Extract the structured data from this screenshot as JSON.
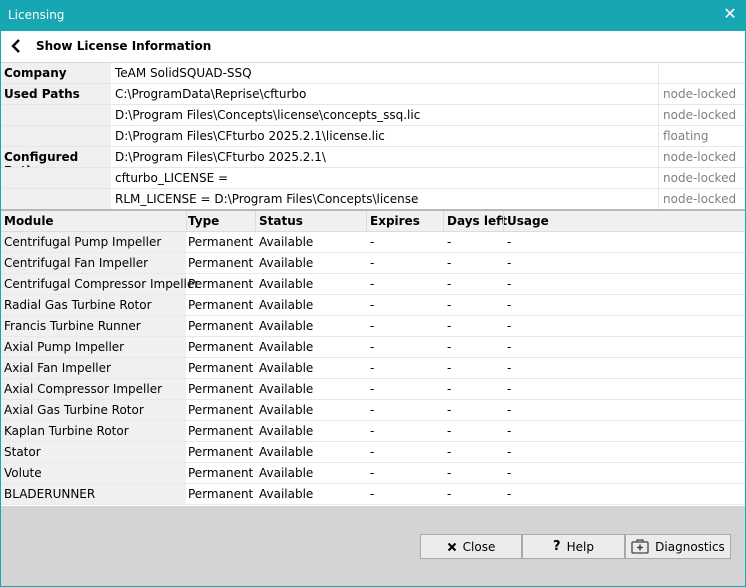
{
  "window": {
    "title": "Licensing"
  },
  "nav": {
    "back_label": "Show License Information"
  },
  "info_rows": [
    {
      "label": "Company",
      "value": "TeAM SolidSQUAD-SSQ",
      "type": ""
    },
    {
      "label": "Used Paths",
      "value": "C:\\ProgramData\\Reprise\\cfturbo",
      "type": "node-locked"
    },
    {
      "label": "",
      "value": "D:\\Program Files\\Concepts\\license\\concepts_ssq.lic",
      "type": "node-locked"
    },
    {
      "label": "",
      "value": "D:\\Program Files\\CFturbo 2025.2.1\\license.lic",
      "type": "floating"
    },
    {
      "label": "Configured Paths",
      "value": "D:\\Program Files\\CFturbo 2025.2.1\\",
      "type": "node-locked"
    },
    {
      "label": "",
      "value": "cfturbo_LICENSE =",
      "type": "node-locked"
    },
    {
      "label": "",
      "value": "RLM_LICENSE = D:\\Program Files\\Concepts\\license",
      "type": "node-locked"
    }
  ],
  "modules": {
    "headers": {
      "module": "Module",
      "type": "Type",
      "status": "Status",
      "expires": "Expires",
      "days_left": "Days left",
      "usage": "Usage"
    },
    "rows": [
      {
        "module": "Centrifugal Pump Impeller",
        "type": "Permanent",
        "status": "Available",
        "expires": "-",
        "days_left": "-",
        "usage": "-"
      },
      {
        "module": "Centrifugal Fan Impeller",
        "type": "Permanent",
        "status": "Available",
        "expires": "-",
        "days_left": "-",
        "usage": "-"
      },
      {
        "module": "Centrifugal Compressor Impeller",
        "type": "Permanent",
        "status": "Available",
        "expires": "-",
        "days_left": "-",
        "usage": "-"
      },
      {
        "module": "Radial Gas Turbine Rotor",
        "type": "Permanent",
        "status": "Available",
        "expires": "-",
        "days_left": "-",
        "usage": "-"
      },
      {
        "module": "Francis Turbine Runner",
        "type": "Permanent",
        "status": "Available",
        "expires": "-",
        "days_left": "-",
        "usage": "-"
      },
      {
        "module": "Axial Pump Impeller",
        "type": "Permanent",
        "status": "Available",
        "expires": "-",
        "days_left": "-",
        "usage": "-"
      },
      {
        "module": "Axial Fan Impeller",
        "type": "Permanent",
        "status": "Available",
        "expires": "-",
        "days_left": "-",
        "usage": "-"
      },
      {
        "module": "Axial Compressor Impeller",
        "type": "Permanent",
        "status": "Available",
        "expires": "-",
        "days_left": "-",
        "usage": "-"
      },
      {
        "module": "Axial Gas Turbine Rotor",
        "type": "Permanent",
        "status": "Available",
        "expires": "-",
        "days_left": "-",
        "usage": "-"
      },
      {
        "module": "Kaplan Turbine Rotor",
        "type": "Permanent",
        "status": "Available",
        "expires": "-",
        "days_left": "-",
        "usage": "-"
      },
      {
        "module": "Stator",
        "type": "Permanent",
        "status": "Available",
        "expires": "-",
        "days_left": "-",
        "usage": "-"
      },
      {
        "module": "Volute",
        "type": "Permanent",
        "status": "Available",
        "expires": "-",
        "days_left": "-",
        "usage": "-"
      },
      {
        "module": "BLADERUNNER",
        "type": "Permanent",
        "status": "Available",
        "expires": "-",
        "days_left": "-",
        "usage": "-"
      }
    ]
  },
  "buttons": {
    "close": "Close",
    "help": "Help",
    "diagnostics": "Diagnostics"
  },
  "colors": {
    "titlebar": "#17a7b2",
    "label_bg": "#f0f0f0",
    "footer_bg": "#d4d4d4",
    "muted_text": "#808080"
  }
}
